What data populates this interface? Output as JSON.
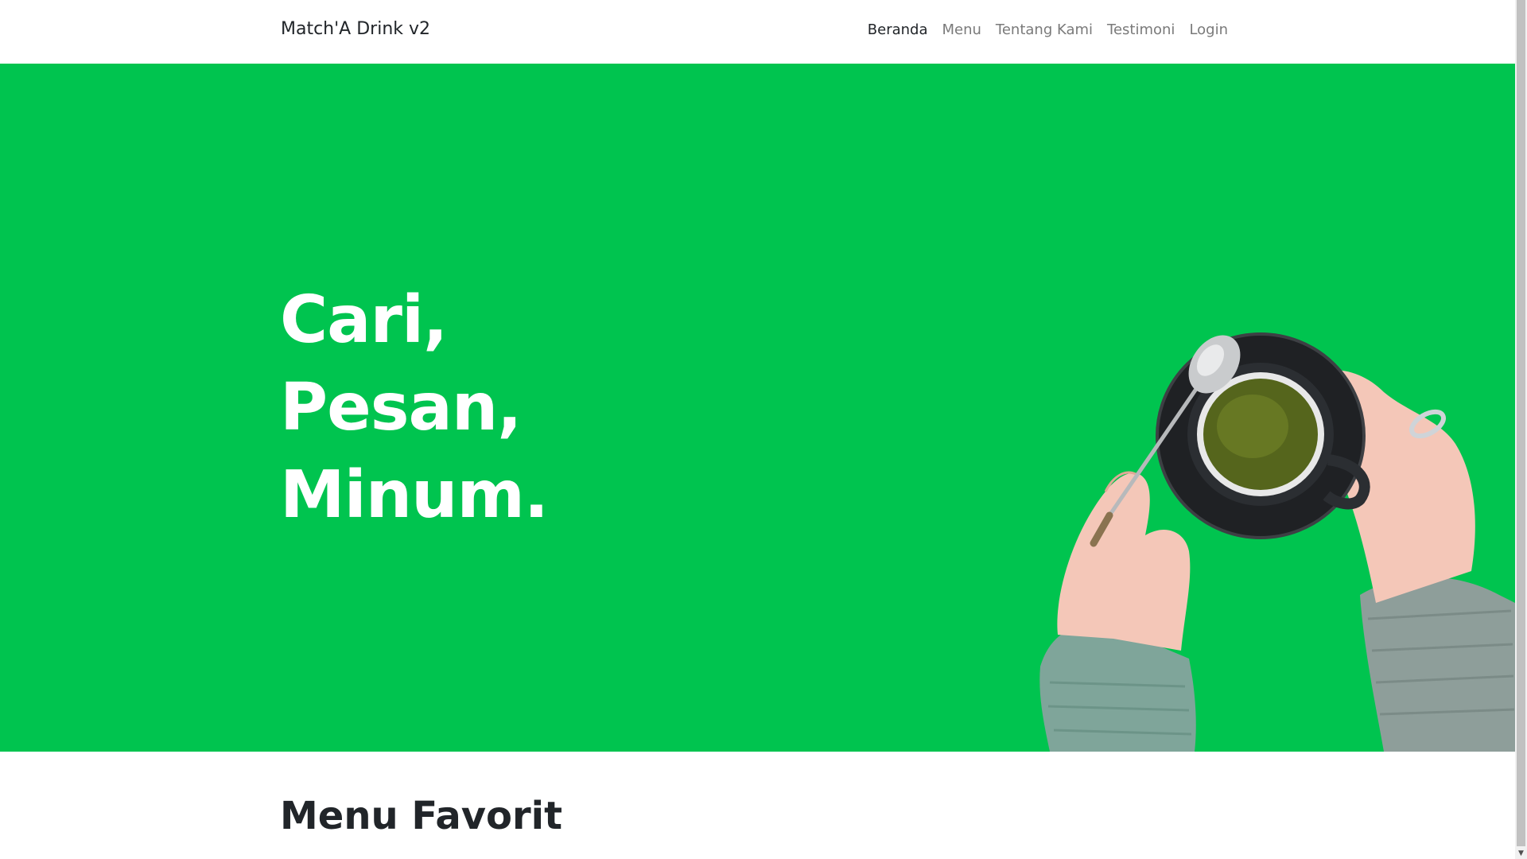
{
  "navbar": {
    "brand": "Match'A Drink v2",
    "links": [
      {
        "label": "Beranda",
        "active": true
      },
      {
        "label": "Menu",
        "active": false
      },
      {
        "label": "Tentang Kami",
        "active": false
      },
      {
        "label": "Testimoni",
        "active": false
      },
      {
        "label": "Login",
        "active": false
      }
    ]
  },
  "hero": {
    "lines": [
      "Cari,",
      "Pesan,",
      "Minum."
    ],
    "background_color": "#00c44f",
    "image_icon": "matcha-cup-hands-illustration"
  },
  "favorites": {
    "title": "Menu Favorit"
  },
  "scrollbar": {
    "down_icon": "chevron-down-icon"
  }
}
